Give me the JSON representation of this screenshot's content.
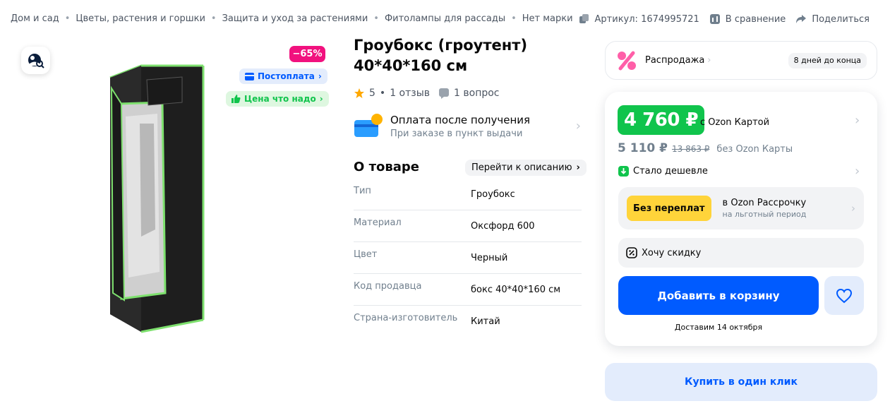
{
  "breadcrumbs": [
    "Дом и сад",
    "Цветы, растения и горшки",
    "Защита и уход за растениями",
    "Фитолампы для рассады",
    "Нет марки"
  ],
  "top_actions": {
    "article": "Артикул: 1674995721",
    "compare": "В сравнение",
    "share": "Поделиться"
  },
  "gallery": {
    "discount": "−65%",
    "postpay": "Постоплата",
    "fair_price": "Цена что надо"
  },
  "product": {
    "title": "Гроубокс (гроутент) 40*40*160 см",
    "rating": "5",
    "reviews": "1 отзыв",
    "questions": "1 вопрос",
    "pay_after_title": "Оплата после получения",
    "pay_after_sub": "При заказе в пункт выдачи"
  },
  "about": {
    "title": "О товаре",
    "goto_description": "Перейти к описанию",
    "specs": [
      {
        "name": "Тип",
        "value": "Гроубокс"
      },
      {
        "name": "Материал",
        "value": "Оксфорд 600"
      },
      {
        "name": "Цвет",
        "value": "Черный"
      },
      {
        "name": "Код продавца",
        "value": "бокс 40*40*160 см"
      },
      {
        "name": "Страна-изготовитель",
        "value": "Китай"
      }
    ]
  },
  "sale": {
    "label": "Распродажа",
    "days_left": "8 дней до конца"
  },
  "pricing": {
    "card_price": "4 760 ₽",
    "card_label": "с Ozon Картой",
    "regular_price": "5 110 ₽",
    "old_price": "13 863 ₽",
    "no_card_label": "без Ozon Карты",
    "cheaper_label": "Стало дешевле",
    "no_overpay": "Без переплат",
    "installment_title": "в Ozon Рассрочку",
    "installment_sub": "на льготный период",
    "want_discount": "Хочу скидку",
    "add_to_cart": "Добавить в корзину",
    "delivery": "Доставим 14 октября",
    "buy_one_click": "Купить в один клик"
  },
  "colors": {
    "brand_blue": "#005bff",
    "discount_pink": "#f1117e",
    "price_green": "#10c44c",
    "installment_yellow": "#ffd43a"
  }
}
